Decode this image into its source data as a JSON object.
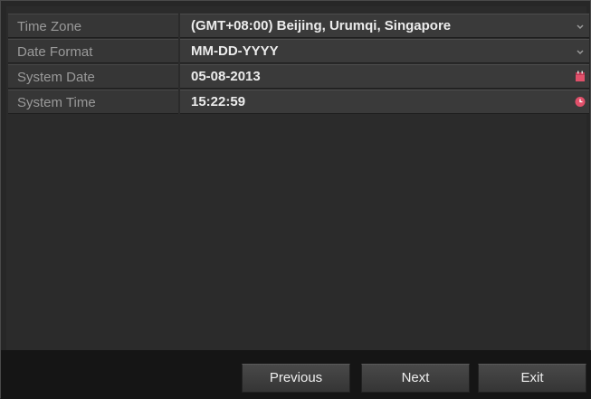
{
  "settings": {
    "rows": [
      {
        "label": "Time Zone",
        "value": "(GMT+08:00) Beijing, Urumqi, Singapore",
        "control_icon": "dropdown-arrow-icon"
      },
      {
        "label": "Date Format",
        "value": "MM-DD-YYYY",
        "control_icon": "dropdown-arrow-icon"
      },
      {
        "label": "System Date",
        "value": "05-08-2013",
        "control_icon": "calendar-icon"
      },
      {
        "label": "System Time",
        "value": "15:22:59",
        "control_icon": "clock-icon"
      }
    ]
  },
  "footer": {
    "previous_label": "Previous",
    "next_label": "Next",
    "exit_label": "Exit"
  },
  "colors": {
    "calendar_icon": "#e0506a",
    "clock_icon": "#e0506a",
    "dropdown_arrow": "#9a9a9a"
  }
}
